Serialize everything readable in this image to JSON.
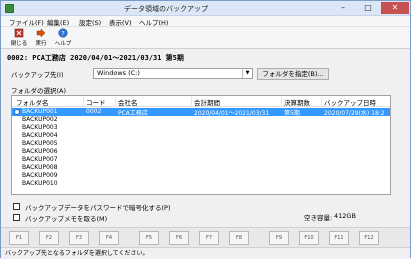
{
  "window": {
    "title": "データ領域のバックアップ"
  },
  "menu": [
    "ファイル(F)",
    "編集(E)",
    "設定(S)",
    "表示(V)",
    "ヘルプ(H)"
  ],
  "toolbar": {
    "close": "閉じる",
    "run": "実行",
    "help": "ヘルプ"
  },
  "company_info": "0002: PCA工務店 2020/04/01～2021/03/31 第5期",
  "backup_target": {
    "label": "バックアップ先(I)",
    "value": "Windows (C:)",
    "specify_button": "フォルダを指定(B)..."
  },
  "folder_select_label": "フォルダの選択(A)",
  "list": {
    "headers": [
      "フォルダ名",
      "コード",
      "会社名",
      "会計期間",
      "決算期数",
      "バックアップ日時"
    ],
    "rows": [
      {
        "folder": "BACKUP001",
        "code": "0002",
        "company": "PCA工務店",
        "period": "2020/04/01～2021/03/31",
        "fiscal": "第5期",
        "date": "2020/07/29(水) 18:2"
      },
      {
        "folder": "BACKUP002"
      },
      {
        "folder": "BACKUP003"
      },
      {
        "folder": "BACKUP004"
      },
      {
        "folder": "BACKUP005"
      },
      {
        "folder": "BACKUP006"
      },
      {
        "folder": "BACKUP007"
      },
      {
        "folder": "BACKUP008"
      },
      {
        "folder": "BACKUP009"
      },
      {
        "folder": "BACKUP010"
      }
    ]
  },
  "options": {
    "encrypt": "バックアップデータをパスワードで暗号化する(P)",
    "memo": "バックアップメモを取る(M)"
  },
  "free_space": {
    "label": "空き容量:",
    "value": "412GB"
  },
  "fkeys": [
    "F1",
    "F2",
    "F3",
    "F4",
    "F5",
    "F6",
    "F7",
    "F8",
    "F9",
    "F10",
    "F11",
    "F12"
  ],
  "status": "バックアップ先となるフォルダを選択してください。",
  "colors": {
    "selection": "#3399ff",
    "title_bar": "#dbe7f6"
  }
}
